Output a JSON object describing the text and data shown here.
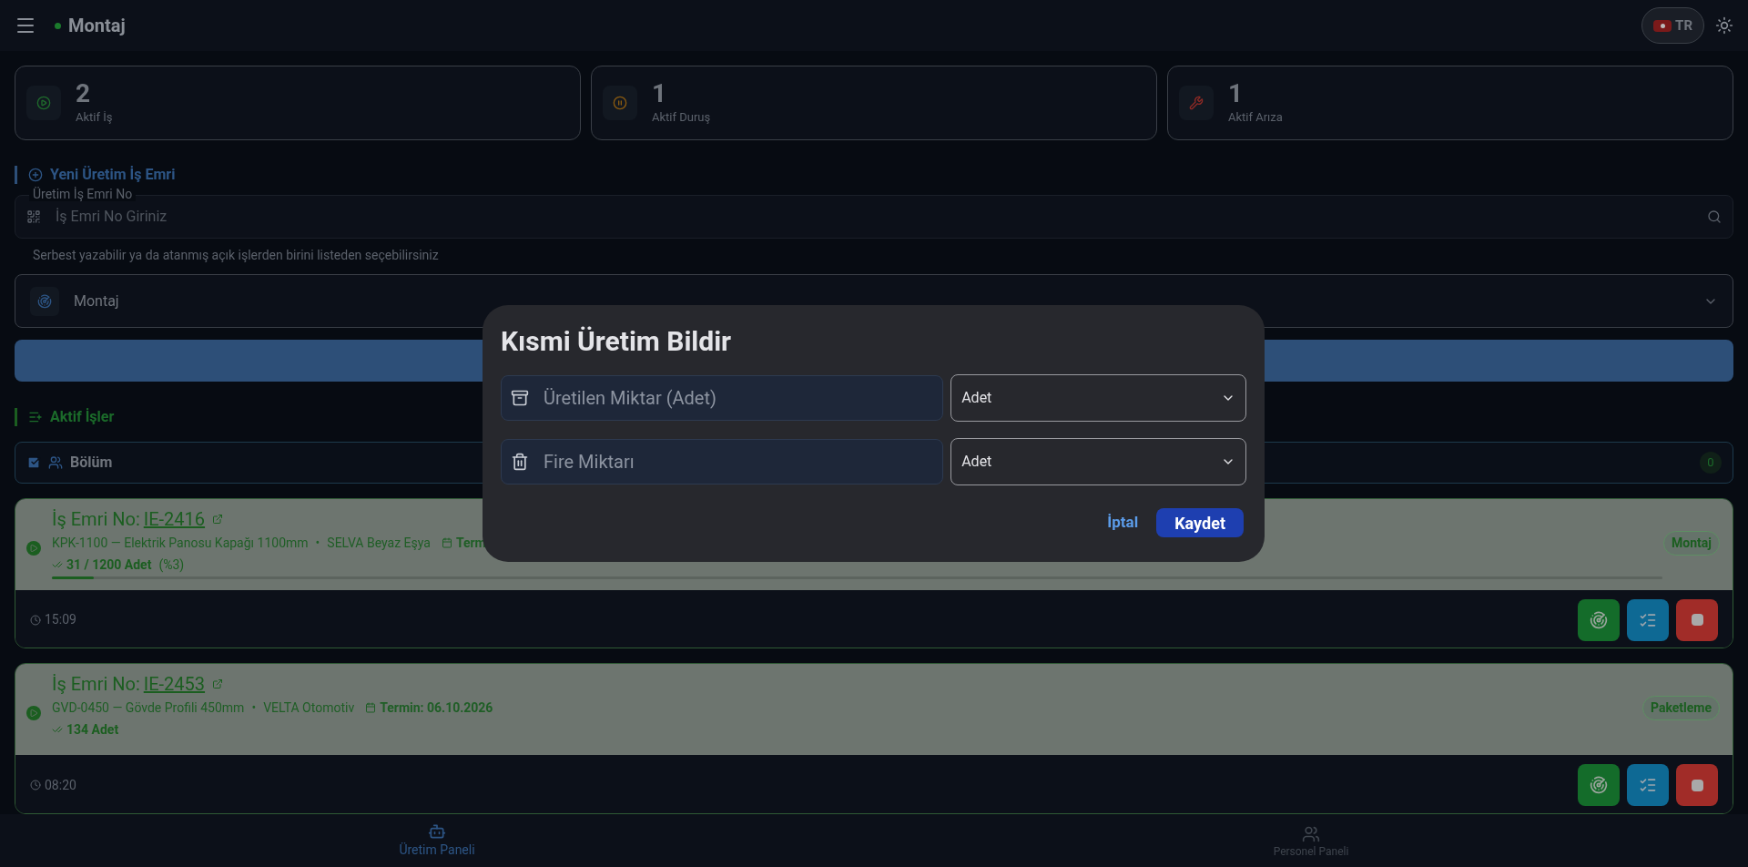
{
  "header": {
    "title": "Montaj",
    "language": "TR"
  },
  "stats": [
    {
      "kind": "work",
      "value": "2",
      "label": "Aktif İş"
    },
    {
      "kind": "pause",
      "value": "1",
      "label": "Aktif Duruş"
    },
    {
      "kind": "fault",
      "value": "1",
      "label": "Aktif Arıza"
    }
  ],
  "new_order": {
    "title": "Yeni Üretim İş Emri",
    "field": {
      "label": "Üretim İş Emri No",
      "placeholder": "İş Emri No Giriniz"
    },
    "helper": "Serbest yazabilir ya da atanmış açık işlerden birini listeden seçebilirsiniz",
    "select": {
      "value": "Montaj"
    }
  },
  "active_jobs": {
    "title": "Aktif İşler",
    "filter": {
      "label": "Bölüm",
      "checked": true,
      "count": "0"
    },
    "jobs": [
      {
        "order_label": "İş Emri No:",
        "order_no": "IE-2416",
        "product": "KPK-1100 — Elektrik Panosu Kapağı 1100mm",
        "separator": "•",
        "customer": "SELVA Beyaz Eşya",
        "due": "Term",
        "quantity": "31 / 1200 Adet",
        "percent": "(%3)",
        "level": 0.026,
        "station": "Montaj",
        "time": "15:09"
      },
      {
        "order_label": "İş Emri No:",
        "order_no": "IE-2453",
        "product": "GVD-0450 — Gövde Profili 450mm",
        "separator": "•",
        "customer": "VELTA Otomotiv",
        "due": "Termin: 06.10.2026",
        "quantity": "134 Adet",
        "station": "Paketleme",
        "time": "08:20"
      }
    ]
  },
  "bottom_nav": [
    {
      "kind": "production",
      "label": "Üretim Paneli",
      "selected": true
    },
    {
      "kind": "staff",
      "label": "Personel Paneli",
      "selected": false
    }
  ],
  "dialog": {
    "title": "Kısmi Üretim Bildir",
    "fields": [
      {
        "kind": "produced",
        "placeholder": "Üretilen Miktar (Adet)",
        "unit": "Adet"
      },
      {
        "kind": "scrap",
        "placeholder": "Fire Miktarı",
        "unit": "Adet"
      }
    ],
    "cancel": "İptal",
    "save": "Kaydet"
  }
}
